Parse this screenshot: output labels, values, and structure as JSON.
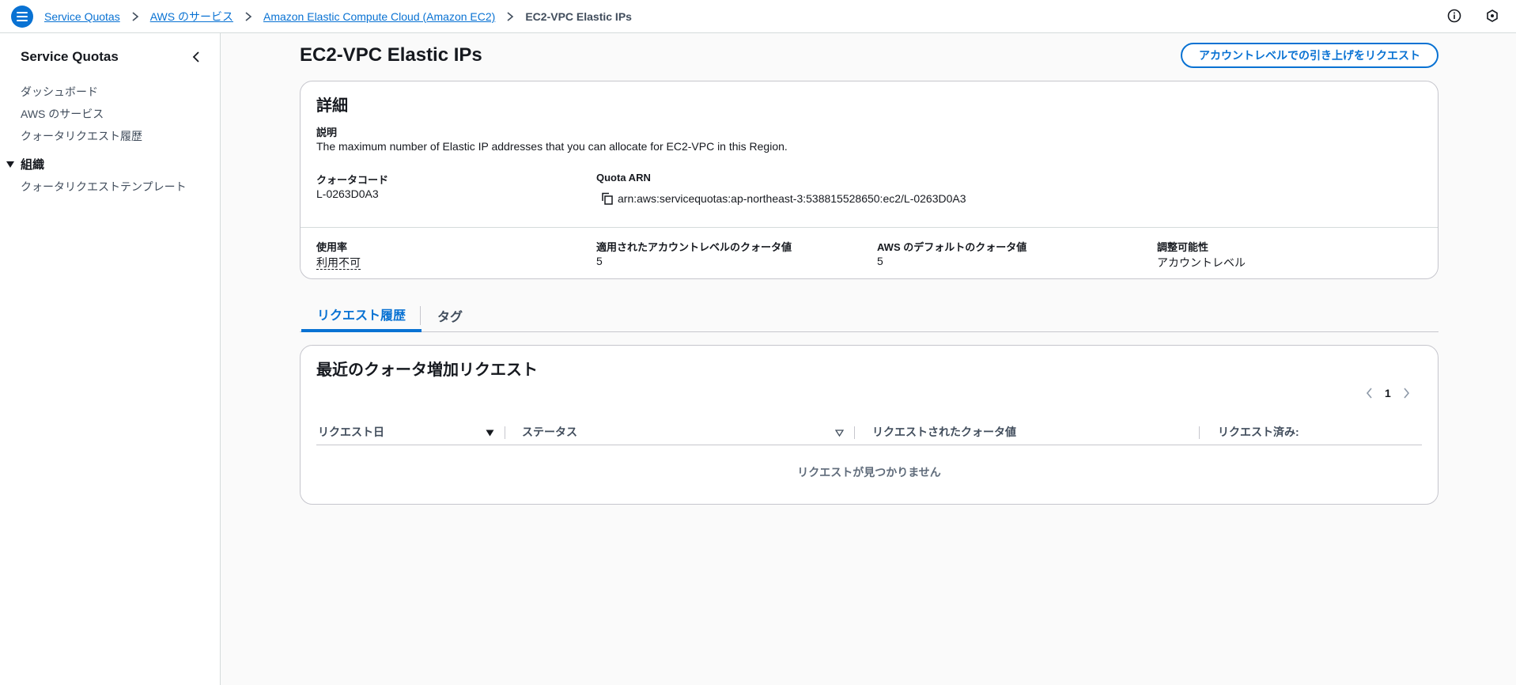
{
  "breadcrumb": {
    "items": [
      "Service Quotas",
      "AWS のサービス",
      "Amazon Elastic Compute Cloud (Amazon EC2)"
    ],
    "current": "EC2-VPC Elastic IPs"
  },
  "sidebar": {
    "title": "Service Quotas",
    "items": [
      {
        "label": "ダッシュボード"
      },
      {
        "label": "AWS のサービス"
      },
      {
        "label": "クォータリクエスト履歴"
      }
    ],
    "section": {
      "label": "組織",
      "items": [
        {
          "label": "クォータリクエストテンプレート"
        }
      ]
    }
  },
  "page": {
    "title": "EC2-VPC Elastic IPs",
    "request_button": "アカウントレベルでの引き上げをリクエスト"
  },
  "details": {
    "title": "詳細",
    "description_label": "説明",
    "description": "The maximum number of Elastic IP addresses that you can allocate for EC2-VPC in this Region.",
    "quota_code_label": "クォータコード",
    "quota_code": "L-0263D0A3",
    "arn_label": "Quota ARN",
    "arn": "arn:aws:servicequotas:ap-northeast-3:538815528650:ec2/L-0263D0A3",
    "usage_label": "使用率",
    "usage": "利用不可",
    "applied_label": "適用されたアカウントレベルのクォータ値",
    "applied": "5",
    "default_label": "AWS のデフォルトのクォータ値",
    "default": "5",
    "adjustable_label": "調整可能性",
    "adjustable": "アカウントレベル"
  },
  "tabs": [
    {
      "label": "リクエスト履歴",
      "active": true
    },
    {
      "label": "タグ",
      "active": false
    }
  ],
  "requests": {
    "title": "最近のクォータ増加リクエスト",
    "page": "1",
    "columns": [
      "リクエスト日",
      "ステータス",
      "リクエストされたクォータ値",
      "リクエスト済み:"
    ],
    "empty": "リクエストが見つかりません"
  },
  "colors": {
    "accent": "#0972d3",
    "text": "#16191f",
    "border": "#c6c6cd"
  },
  "icons": {
    "menu": "hamburger-menu-icon",
    "breadcrumb_separator": "chevron-right-icon",
    "info": "info-icon",
    "notifications": "notifications-icon",
    "sidebar_close": "chevron-left-icon",
    "copy": "copy-icon",
    "sort_active": "caret-down-filled-icon",
    "sort": "caret-down-outline-icon",
    "pager_prev": "chevron-left-icon",
    "pager_next": "chevron-right-icon"
  }
}
